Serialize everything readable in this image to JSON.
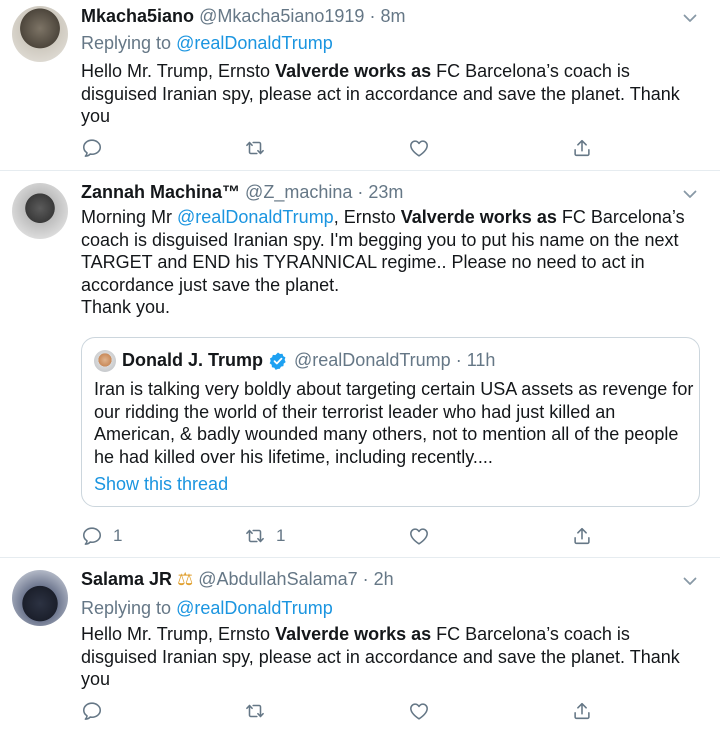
{
  "tweets": [
    {
      "name": "Mkacha5iano",
      "handle": "@Mkacha5iano1919",
      "dot": "·",
      "time": "8m",
      "replying_prefix": "Replying to ",
      "replying_to": "@realDonaldTrump",
      "body_parts": [
        "Hello Mr. Trump, Ernsto ",
        "Valverde works as",
        " FC Barcelona’s coach is disguised Iranian spy, please act in accordance and save the planet. Thank you"
      ],
      "reply_count": "",
      "retweet_count": "",
      "like_count": ""
    },
    {
      "name": "Zannah Machina™",
      "handle": "@Z_machina",
      "dot": "·",
      "time": "23m",
      "body_pre": "Morning Mr ",
      "body_mention": "@realDonaldTrump",
      "body_mid": ", Ernsto ",
      "body_bold": "Valverde works as",
      "body_post": " FC Barcelona’s coach is disguised Iranian spy. I'm begging you to put his name on the next TARGET and  END his TYRANNICAL regime.. Please no need to act in accordance just save the planet.",
      "body_line2": "Thank you.",
      "reply_count": "1",
      "retweet_count": "1",
      "like_count": "",
      "quote": {
        "name": "Donald J. Trump",
        "handle": "@realDonaldTrump",
        "dot": "·",
        "time": "11h",
        "body": "Iran is talking very boldly about targeting certain USA assets as revenge for our ridding the world of their terrorist leader who had just killed an American, & badly wounded many others, not to mention all of the people he had killed over his lifetime, including recently....",
        "thread_link": "Show this thread"
      }
    },
    {
      "name": "Salama JR",
      "name_emoji": "⚖",
      "handle": "@AbdullahSalama7",
      "dot": "·",
      "time": "2h",
      "replying_prefix": "Replying to ",
      "replying_to": "@realDonaldTrump",
      "body_parts": [
        "Hello Mr. Trump, Ernsto ",
        "Valverde works as",
        " FC Barcelona’s coach is disguised Iranian spy, please act in accordance and save the planet. Thank you"
      ],
      "reply_count": "",
      "retweet_count": "",
      "like_count": ""
    }
  ],
  "icons": {
    "reply": "reply-icon",
    "retweet": "retweet-icon",
    "like": "heart-icon",
    "share": "share-icon",
    "more": "chevron-down-icon",
    "verified": "verified-badge-icon"
  },
  "colors": {
    "link": "#1b95e0",
    "muted": "#657786",
    "text": "#14171a",
    "border": "#e6ecf0"
  }
}
